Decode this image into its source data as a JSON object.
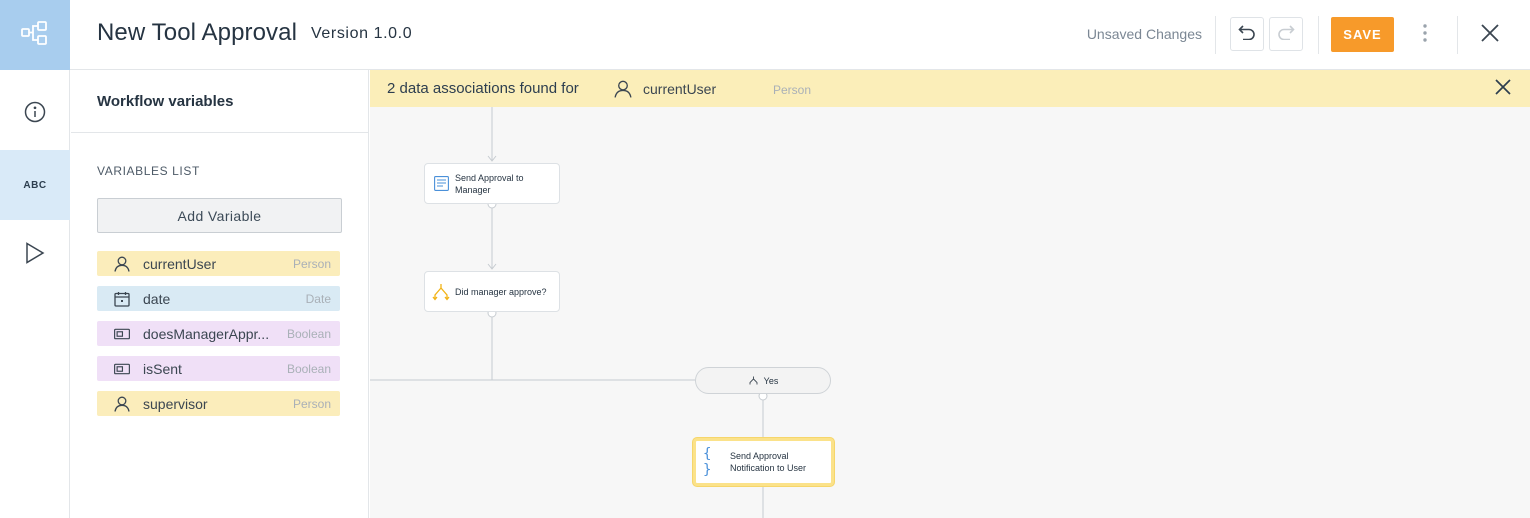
{
  "header": {
    "title": "New Tool Approval",
    "version": "Version 1.0.0",
    "status": "Unsaved Changes",
    "save_label": "SAVE",
    "logo_icon": "workflow-icon",
    "accent_color": "#f79a2a"
  },
  "rail": {
    "items": [
      {
        "icon": "info-icon"
      },
      {
        "label": "ABC",
        "icon": "variables-icon",
        "active": true
      },
      {
        "icon": "play-icon"
      }
    ]
  },
  "panel": {
    "title": "Workflow variables",
    "section_label": "VARIABLES LIST",
    "add_label": "Add Variable",
    "variables": [
      {
        "name": "currentUser",
        "type": "Person",
        "icon": "person-icon"
      },
      {
        "name": "date",
        "type": "Date",
        "icon": "calendar-icon"
      },
      {
        "name": "doesManagerAppr...",
        "type": "Boolean",
        "icon": "boolean-icon"
      },
      {
        "name": "isSent",
        "type": "Boolean",
        "icon": "boolean-icon"
      },
      {
        "name": "supervisor",
        "type": "Person",
        "icon": "person-icon"
      }
    ]
  },
  "banner": {
    "text": "2 data associations found for",
    "variable": "currentUser",
    "type": "Person"
  },
  "flow": {
    "nodes": [
      {
        "label": "Send Approval to Manager",
        "icon": "form-icon"
      },
      {
        "label": "Did manager approve?",
        "icon": "decision-icon"
      },
      {
        "label": "Send Approval Notification to User",
        "icon": "script-icon",
        "selected": true
      }
    ],
    "branch_label": "Yes"
  }
}
